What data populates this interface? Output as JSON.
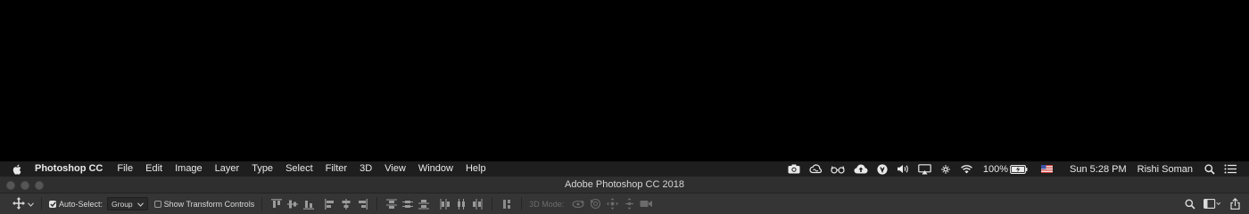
{
  "menubar": {
    "app_name": "Photoshop CC",
    "items": [
      "File",
      "Edit",
      "Image",
      "Layer",
      "Type",
      "Select",
      "Filter",
      "3D",
      "View",
      "Window",
      "Help"
    ],
    "battery": "100%",
    "clock": "Sun 5:28 PM",
    "user": "Rishi Soman"
  },
  "window": {
    "title": "Adobe Photoshop CC 2018"
  },
  "options": {
    "auto_select_label": "Auto-Select:",
    "auto_select_checked": true,
    "auto_select_target": "Group",
    "show_transform_label": "Show Transform Controls",
    "show_transform_checked": false,
    "mode_3d_label": "3D Mode:"
  },
  "colors": {
    "menubar_bg": "#1e1e1e",
    "titlebar_bg": "#2f2f2f",
    "optionsbar_bg": "#353535",
    "flag_red": "#c83a3a",
    "flag_blue": "#3a55a8"
  }
}
